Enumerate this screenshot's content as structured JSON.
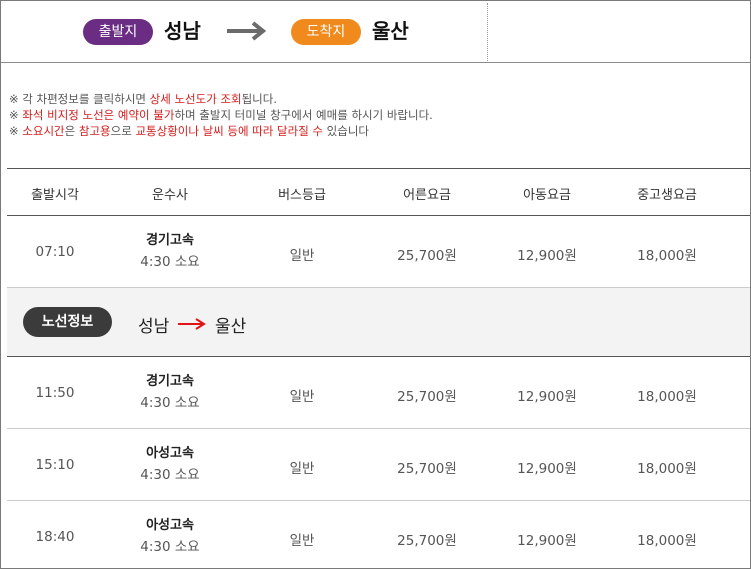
{
  "route": {
    "departure_tag": "출발지",
    "departure_city": "성남",
    "arrival_tag": "도착지",
    "arrival_city": "울산",
    "colors": {
      "departure": "#6a2d83",
      "arrival": "#f08a1c"
    }
  },
  "notes": [
    {
      "prefix": "※ 각 차편정보를 클릭하시면 ",
      "highlight": "상세 노선도가 조회",
      "suffix": "됩니다."
    },
    {
      "prefix": "※ ",
      "highlight": "좌석 비지정 노선은 예약이 불가",
      "suffix": "하며 출발지 터미널 창구에서 예매를 하시기 바랍니다."
    },
    {
      "prefix": "※ ",
      "highlight": "소요시간",
      "mid": "은 ",
      "highlight2": "참고용",
      "mid2": "으로 ",
      "highlight3": "교통상황이나 날씨 등에 따라 달라질 수",
      "suffix": " 있습니다"
    }
  ],
  "table": {
    "headers": [
      "출발시각",
      "운수사",
      "버스등급",
      "어른요금",
      "아동요금",
      "중고생요금"
    ],
    "first_group": [
      {
        "time": "07:10",
        "company": "경기고속",
        "duration": "4:30 소요",
        "grade": "일반",
        "adult": "25,700원",
        "child": "12,900원",
        "student": "18,000원"
      }
    ],
    "route_info": {
      "badge": "노선정보",
      "from": "성남",
      "to": "울산"
    },
    "second_group": [
      {
        "time": "11:50",
        "company": "경기고속",
        "duration": "4:30 소요",
        "grade": "일반",
        "adult": "25,700원",
        "child": "12,900원",
        "student": "18,000원"
      },
      {
        "time": "15:10",
        "company": "아성고속",
        "duration": "4:30 소요",
        "grade": "일반",
        "adult": "25,700원",
        "child": "12,900원",
        "student": "18,000원"
      },
      {
        "time": "18:40",
        "company": "아성고속",
        "duration": "4:30 소요",
        "grade": "일반",
        "adult": "25,700원",
        "child": "12,900원",
        "student": "18,000원"
      }
    ]
  }
}
